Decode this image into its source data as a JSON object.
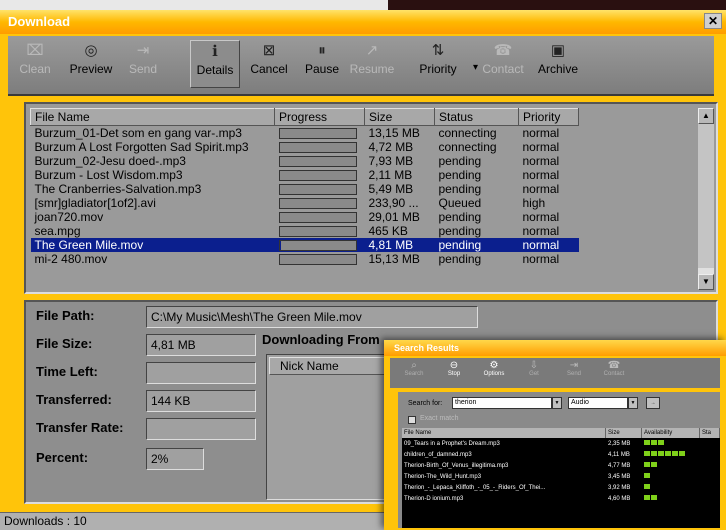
{
  "window": {
    "title": "Download",
    "close_glyph": "✕"
  },
  "toolbar": [
    {
      "label": "Clean",
      "icon": "clean-icon",
      "glyph": "⌧",
      "enabled": false
    },
    {
      "label": "Preview",
      "icon": "preview-icon",
      "glyph": "◎",
      "enabled": true
    },
    {
      "label": "Send",
      "icon": "send-icon",
      "glyph": "⇥",
      "enabled": false
    },
    {
      "label": "Details",
      "icon": "details-icon",
      "glyph": "ℹ",
      "enabled": true,
      "active": true
    },
    {
      "label": "Cancel",
      "icon": "cancel-icon",
      "glyph": "⊠",
      "enabled": true
    },
    {
      "label": "Pause",
      "icon": "pause-icon",
      "glyph": "⏸",
      "enabled": true
    },
    {
      "label": "Resume",
      "icon": "resume-icon",
      "glyph": "↗",
      "enabled": false
    },
    {
      "label": "Priority",
      "icon": "priority-icon",
      "glyph": "⇅",
      "enabled": true,
      "dropdown": "▾"
    },
    {
      "label": "Contact",
      "icon": "contact-icon",
      "glyph": "☎",
      "enabled": false
    },
    {
      "label": "Archive",
      "icon": "archive-icon",
      "glyph": "▣",
      "enabled": true
    }
  ],
  "file_list": {
    "columns": [
      "File Name",
      "Progress",
      "Size",
      "Status",
      "Priority"
    ],
    "rows": [
      {
        "name": "Burzum_01-Det som en gang var-.mp3",
        "progress": 0,
        "size": "13,15 MB",
        "status": "connecting",
        "priority": "normal"
      },
      {
        "name": "Burzum  A Lost Forgotten Sad Spirit.mp3",
        "progress": 0,
        "size": "4,72 MB",
        "status": "connecting",
        "priority": "normal"
      },
      {
        "name": "Burzum_02-Jesu doed-.mp3",
        "progress": 0,
        "size": "7,93 MB",
        "status": "pending",
        "priority": "normal"
      },
      {
        "name": "Burzum - Lost Wisdom.mp3",
        "progress": 0,
        "size": "2,11 MB",
        "status": "pending",
        "priority": "normal"
      },
      {
        "name": "The Cranberries-Salvation.mp3",
        "progress": 0,
        "size": "5,49 MB",
        "status": "pending",
        "priority": "normal"
      },
      {
        "name": "[smr]gladiator[1of2].avi",
        "progress": 0,
        "size": "233,90 ...",
        "status": "Queued",
        "priority": "high"
      },
      {
        "name": "joan720.mov",
        "progress": 0,
        "size": "29,01 MB",
        "status": "pending",
        "priority": "normal"
      },
      {
        "name": "sea.mpg",
        "progress": 0,
        "size": "465 KB",
        "status": "pending",
        "priority": "normal"
      },
      {
        "name": "The Green Mile.mov",
        "progress": 0.02,
        "size": "4,81 MB",
        "status": "pending",
        "priority": "normal",
        "selected": true
      },
      {
        "name": "mi-2  480.mov",
        "progress": 0,
        "size": "15,13 MB",
        "status": "pending",
        "priority": "normal"
      }
    ]
  },
  "details": {
    "file_path_label": "File Path:",
    "file_path": "C:\\My Music\\Mesh\\The Green Mile.mov",
    "file_size_label": "File Size:",
    "file_size": "4,81 MB",
    "time_left_label": "Time Left:",
    "time_left": "",
    "transferred_label": "Transferred:",
    "transferred": "144 KB",
    "transfer_rate_label": "Transfer Rate:",
    "transfer_rate": "",
    "percent_label": "Percent:",
    "percent": "2%",
    "downloading_from_label": "Downloading From",
    "nick_column": "Nick Name"
  },
  "status_bar": {
    "downloads": "Downloads : 10"
  },
  "search_window": {
    "title": "Search Results",
    "toolbar": [
      {
        "label": "Search",
        "glyph": "⌕",
        "on": false
      },
      {
        "label": "Stop",
        "glyph": "⊖",
        "on": true
      },
      {
        "label": "Options",
        "glyph": "⚙",
        "on": true
      },
      {
        "label": "Get",
        "glyph": "⇩",
        "on": false
      },
      {
        "label": "Send",
        "glyph": "⇥",
        "on": false
      },
      {
        "label": "Contact",
        "glyph": "☎",
        "on": false
      }
    ],
    "search_for_label": "Search for:",
    "query": "therion",
    "type": "Audio",
    "checkbox_label": "Exact match",
    "columns": [
      "File Name",
      "Size",
      "Availability",
      "Sta"
    ],
    "results": [
      {
        "name": "09_Tears in a Prophet's Dream.mp3",
        "size": "2,35 MB",
        "avail": 3
      },
      {
        "name": "children_of_damned.mp3",
        "size": "4,11 MB",
        "avail": 6
      },
      {
        "name": "Therion-Birth_Of_Venus_illegitima.mp3",
        "size": "4,77 MB",
        "avail": 2
      },
      {
        "name": "Therion-The_Wild_Hunt.mp3",
        "size": "3,45 MB",
        "avail": 1
      },
      {
        "name": "Therion_-_Lepaca_Kliffoth_-_05_-_Riders_Of_Thei...",
        "size": "3,92 MB",
        "avail": 1
      },
      {
        "name": "Therion-D ionium.mp3",
        "size": "4,60 MB",
        "avail": 2
      }
    ]
  }
}
